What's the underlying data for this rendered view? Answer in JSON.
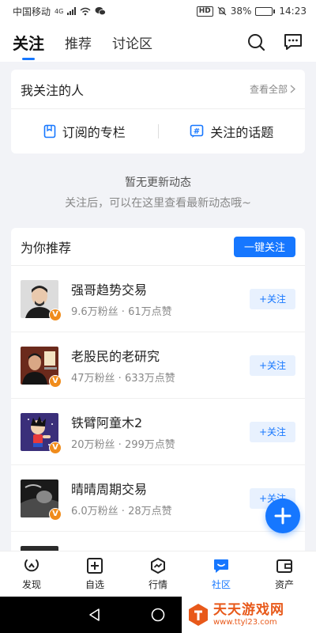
{
  "status_bar": {
    "carrier": "中国移动",
    "network": "4G",
    "battery": "38%",
    "battery_level": 0.38,
    "time": "14:23"
  },
  "top_nav": {
    "tabs": [
      "关注",
      "推荐",
      "讨论区"
    ],
    "active_tab": 0,
    "icons": [
      "search-icon",
      "message-icon"
    ]
  },
  "following": {
    "title": "我关注的人",
    "view_all": "查看全部",
    "links": [
      {
        "label": "订阅的专栏",
        "icon": "bookmark-icon"
      },
      {
        "label": "关注的话题",
        "icon": "hashtag-icon"
      }
    ]
  },
  "empty_state": {
    "title": "暂无更新动态",
    "subtitle": "关注后，可以在这里查看最新动态哦~"
  },
  "recommend": {
    "title": "为你推荐",
    "follow_all_label": "一键关注",
    "follow_label": "+关注",
    "items": [
      {
        "name": "强哥趋势交易",
        "meta": "9.6万粉丝 · 61万点赞"
      },
      {
        "name": "老股民的老研究",
        "meta": "47万粉丝 · 633万点赞"
      },
      {
        "name": "铁臂阿童木2",
        "meta": "20万粉丝 · 299万点赞"
      },
      {
        "name": "晴晴周期交易",
        "meta": "6.0万粉丝 · 28万点赞"
      }
    ]
  },
  "bottom_nav": {
    "items": [
      {
        "label": "发现",
        "icon": "discover-icon"
      },
      {
        "label": "自选",
        "icon": "add-watchlist-icon"
      },
      {
        "label": "行情",
        "icon": "market-icon"
      },
      {
        "label": "社区",
        "icon": "community-icon"
      },
      {
        "label": "资产",
        "icon": "wallet-icon"
      }
    ],
    "active": 3
  },
  "watermark": {
    "title": "天天游戏网",
    "url": "www.ttyl23.com"
  },
  "colors": {
    "accent": "#1677ff",
    "badge": "#f08c1c",
    "watermark": "#e8591a"
  }
}
